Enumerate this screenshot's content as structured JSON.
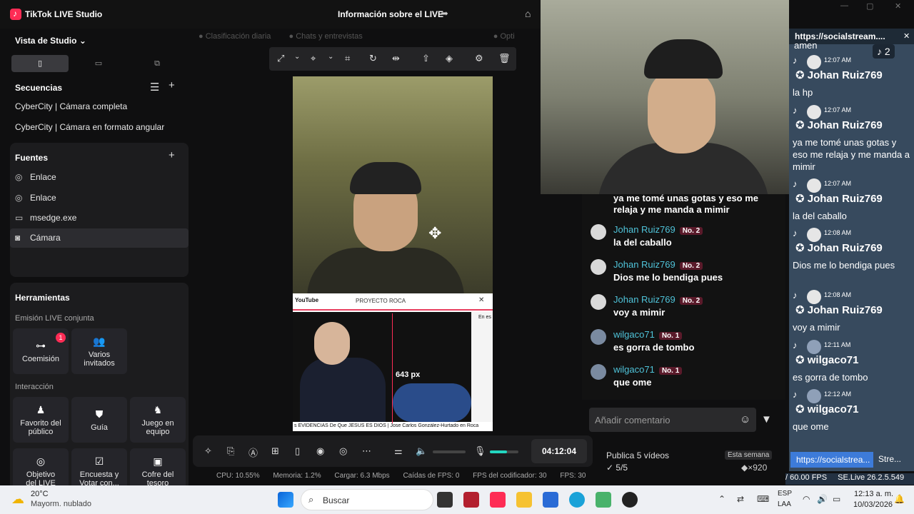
{
  "app": {
    "title": "TikTok LIVE Studio",
    "center_title": "Información sobre el LIVE"
  },
  "studio": {
    "header": "Vista de Studio",
    "sequences_header": "Secuencias",
    "sequences": [
      "CyberCity | Cámara completa",
      "CyberCity | Cámara en formato angular"
    ],
    "sources_header": "Fuentes",
    "sources": [
      {
        "label": "Enlace",
        "icon": "globe-icon"
      },
      {
        "label": "Enlace",
        "icon": "globe-icon"
      },
      {
        "label": "msedge.exe",
        "icon": "window-icon"
      },
      {
        "label": "Cámara",
        "icon": "camera-icon"
      }
    ],
    "tools_header": "Herramientas",
    "joint_live": "Emisión LIVE conjunta",
    "cohost_label": "Coemisión",
    "cohost_badge": "1",
    "guests_label": "Varios invitados",
    "interaction": "Interacción",
    "interaction_tools": [
      "Favorito del público",
      "Guía",
      "Juego en equipo",
      "Objetivo del LIVE",
      "Encuesta y Votar con...",
      "Cofre del tesoro"
    ]
  },
  "tabs": [
    "Clasificación diaria",
    "Chats y entrevistas",
    "Opti"
  ],
  "preview": {
    "yt_logo": "YouTube",
    "yt_title": "PROYECTO ROCA",
    "yt_side": "En es",
    "caption": "s EVIDENCIAS De Que JESÚS ES DIOS | Jose Carlos González-Hurtado en Roca",
    "measure": "643 px"
  },
  "bottombar": {
    "timer": "04:12:04",
    "mic_level": 0.6
  },
  "stats": {
    "cpu": "CPU: 10.55%",
    "mem": "Memoria: 1.2%",
    "upload": "Cargar: 6.3 Mbps",
    "fps_drop": "Caídas de FPS: 0",
    "encoder": "FPS del codificador: 30",
    "fps": "FPS: 30"
  },
  "chat": {
    "partial": "ya me tomé unas gotas y eso me relaja y me manda a mimir",
    "messages": [
      {
        "name": "Johan Ruiz769",
        "rank": "No. 2",
        "text": "la del caballo"
      },
      {
        "name": "Johan Ruiz769",
        "rank": "No. 2",
        "text": "Dios me lo bendiga pues"
      },
      {
        "name": "Johan Ruiz769",
        "rank": "No. 2",
        "text": "voy a mimir"
      },
      {
        "name": "wilgaco71",
        "rank": "No. 1",
        "text": "es gorra de tombo"
      },
      {
        "name": "wilgaco71",
        "rank": "No. 1",
        "text": "que ome"
      }
    ],
    "comment_placeholder": "Añadir comentario"
  },
  "publish": {
    "label": "Publica 5 vídeos",
    "progress": "5/5",
    "period": "Esta semana",
    "reward": "×920"
  },
  "social": {
    "title": "https://socialstream....",
    "count": "2",
    "partial_top": "amen",
    "messages": [
      {
        "time": "12:07 AM",
        "name": "Johan Ruiz769",
        "text": "la hp"
      },
      {
        "time": "12:07 AM",
        "name": "Johan Ruiz769",
        "text": "ya me tomé unas gotas y eso me relaja y me manda a mimir"
      },
      {
        "time": "12:07 AM",
        "name": "Johan Ruiz769",
        "text": "la del caballo"
      },
      {
        "time": "12:08 AM",
        "name": "Johan Ruiz769",
        "text": "Dios me lo bendiga pues"
      },
      {
        "time": "12:08 AM",
        "name": "Johan Ruiz769",
        "text": "voy a mimir"
      },
      {
        "time": "12:11 AM",
        "name": "wilgaco71",
        "text": "es gorra de tombo"
      },
      {
        "time": "12:12 AM",
        "name": "wilgaco71",
        "text": "que ome"
      }
    ],
    "tab1": "https://socialstrea...",
    "tab2": "Stre...",
    "status_fps": "/ 60.00 FPS",
    "status_version": "SE.Live 26.2.5.549"
  },
  "taskbar": {
    "temp": "20°C",
    "weather": "Mayorm. nublado",
    "search_placeholder": "Buscar",
    "lang1": "ESP",
    "lang2": "LAA",
    "time": "12:13 a. m.",
    "date": "10/03/2026"
  }
}
